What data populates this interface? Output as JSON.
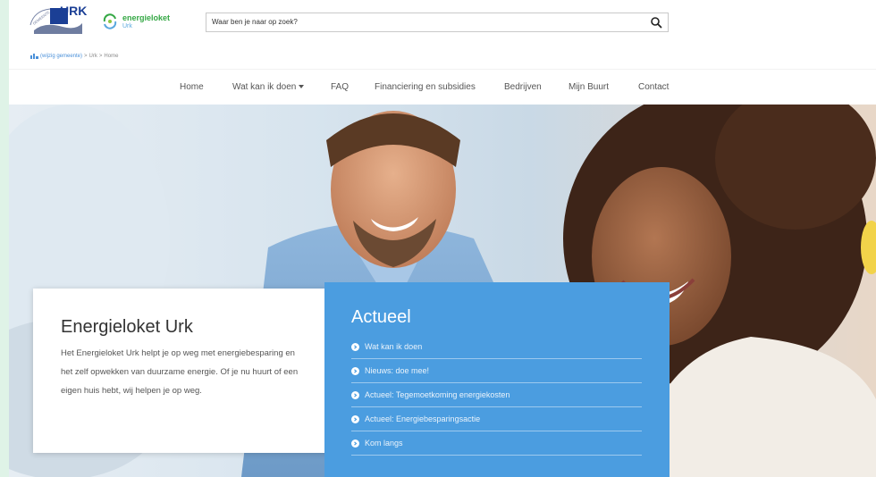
{
  "header": {
    "logo_urk_text": "URK",
    "logo_urk_curve_text": "GEMEENTE",
    "logo_el_name": "energieloket",
    "logo_el_place": "Urk",
    "search": {
      "placeholder": "Waar ben je naar op zoek?"
    },
    "search_icon": "search-icon"
  },
  "breadcrumb": {
    "change_link": "(wijzig gemeente)",
    "sep1": ">",
    "level1": "Urk",
    "sep2": ">",
    "current": "Home"
  },
  "nav": {
    "items": [
      {
        "label": "Home"
      },
      {
        "label": "Wat kan ik doen",
        "has_dropdown": true
      },
      {
        "label": "FAQ"
      },
      {
        "label": "Financiering en subsidies"
      },
      {
        "label": "Bedrijven"
      },
      {
        "label": "Mijn Buurt"
      },
      {
        "label": "Contact"
      }
    ]
  },
  "intro": {
    "title": "Energieloket Urk",
    "body": "Het Energieloket Urk helpt je op weg met energiebesparing en het zelf opwekken van duurzame energie. Of je nu huurt of een eigen huis hebt, wij helpen je op weg."
  },
  "actueel": {
    "title": "Actueel",
    "items": [
      {
        "label": "Wat kan ik doen"
      },
      {
        "label": "Nieuws: doe mee!"
      },
      {
        "label": "Actueel: Tegemoetkoming energiekosten"
      },
      {
        "label": "Actueel: Energiebesparingsactie"
      },
      {
        "label": "Kom langs"
      }
    ]
  },
  "colors": {
    "accent_blue": "#4b9de0",
    "logo_green": "#35a845",
    "page_frame": "#dff3e7"
  }
}
